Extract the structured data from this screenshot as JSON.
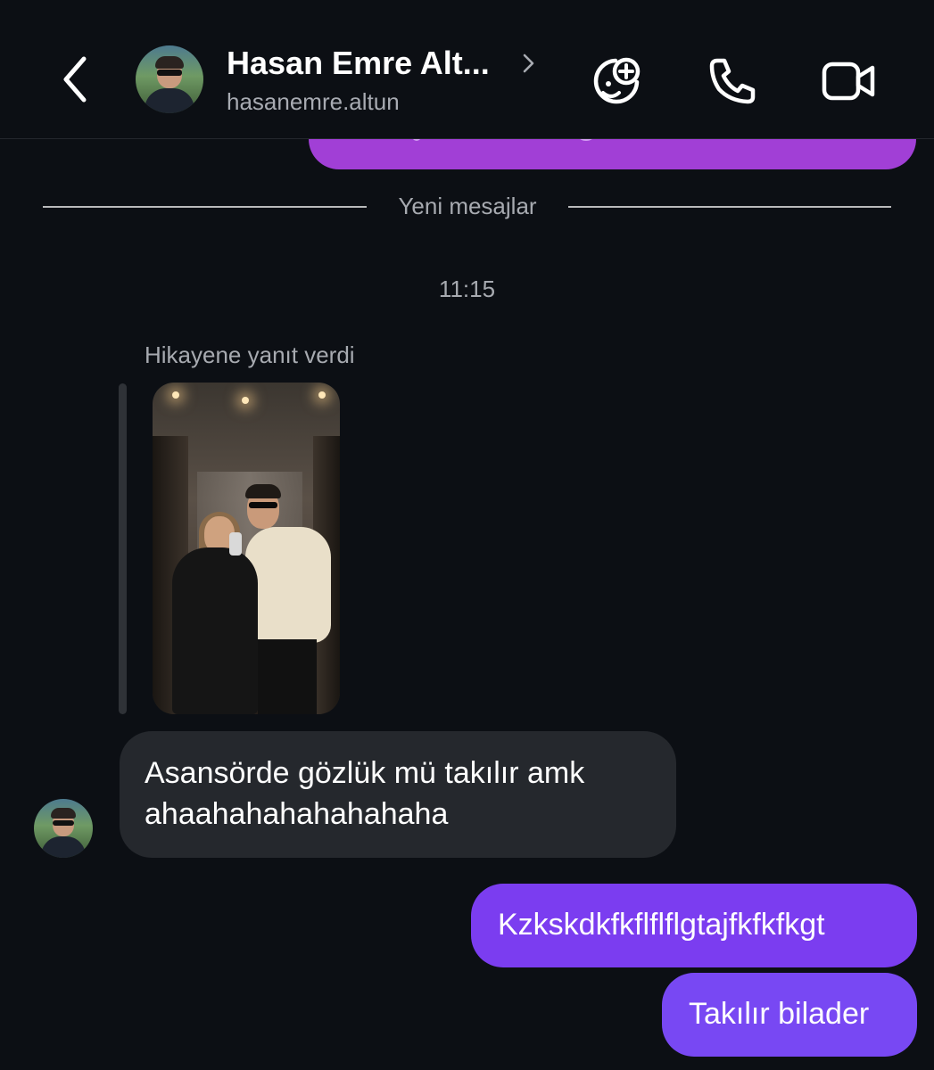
{
  "header": {
    "contact_name": "Hasan Emre Alt...",
    "username": "hasanemre.altun",
    "icons": {
      "back": "chevron-left-icon",
      "name_chevron": "chevron-right-icon",
      "sticker": "sticker-add-icon",
      "call": "phone-icon",
      "video": "video-camera-icon"
    }
  },
  "chat": {
    "divider_text": "Yeni mesajlar",
    "timestamp": "11:15",
    "reply_label": "Hikayene yanıt verdi",
    "incoming_message": {
      "line1": "Asansörde gözlük mü takılır amk",
      "line2": "ahaahahahahahahaha"
    },
    "outgoing_messages": [
      {
        "text": "Kzkskdkfkflflflgtajfkfkfkgt"
      },
      {
        "text": "Takılır bilader"
      }
    ]
  },
  "colors": {
    "background": "#0c0f14",
    "incoming_bubble": "#25282d",
    "outgoing_bubble": "#7b3df0",
    "previous_bubble": "#a13fd6",
    "secondary_text": "#a7aab0"
  }
}
